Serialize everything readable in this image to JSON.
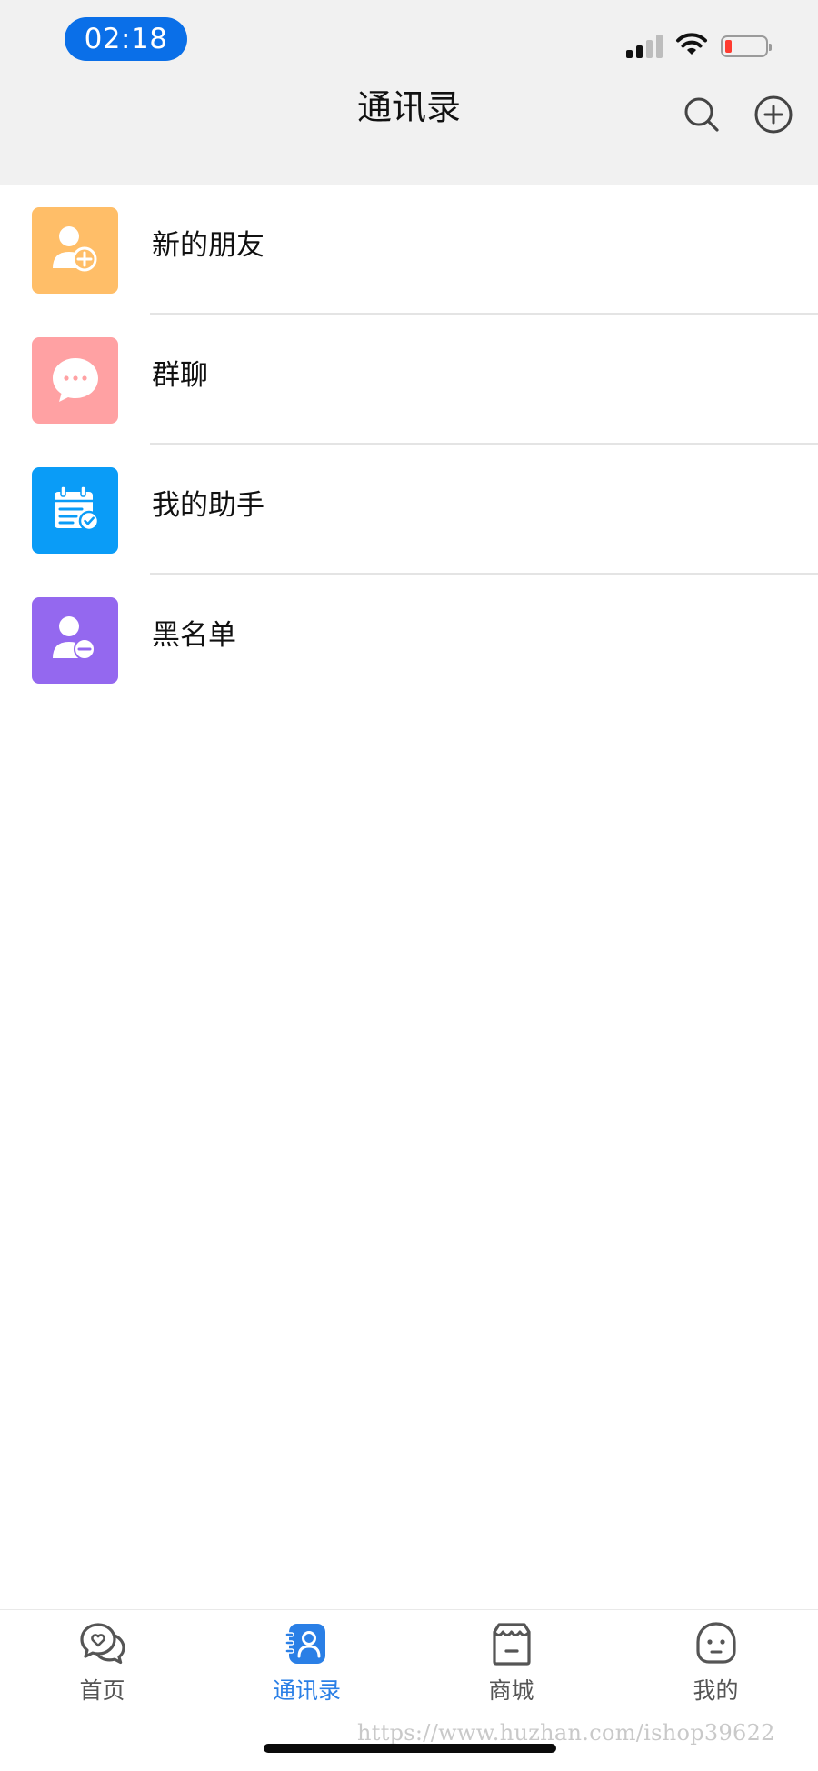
{
  "status_bar": {
    "time": "02:18",
    "battery_level_percent": 10,
    "battery_color": "#ff3b30",
    "signal_bars_active": 2,
    "signal_bars_total": 4
  },
  "header": {
    "title": "通讯录",
    "search_icon": "search-icon",
    "add_icon": "plus-circle-icon",
    "background": "#f1f1f1"
  },
  "list": {
    "items": [
      {
        "label": "新的朋友",
        "icon": "add-friend-icon",
        "color": "#ffbe68"
      },
      {
        "label": "群聊",
        "icon": "group-chat-icon",
        "color": "#ffa1a3"
      },
      {
        "label": "我的助手",
        "icon": "assistant-calendar-icon",
        "color": "#0a9cf7"
      },
      {
        "label": "黑名单",
        "icon": "blacklist-icon",
        "color": "#9468ef"
      }
    ]
  },
  "tabbar": {
    "active_color": "#2a7fe6",
    "tabs": [
      {
        "label": "首页",
        "icon": "home-chat-icon",
        "active": false
      },
      {
        "label": "通讯录",
        "icon": "contacts-icon",
        "active": true
      },
      {
        "label": "商城",
        "icon": "store-icon",
        "active": false
      },
      {
        "label": "我的",
        "icon": "profile-icon",
        "active": false
      }
    ]
  },
  "watermark": "https://www.huzhan.com/ishop39622"
}
